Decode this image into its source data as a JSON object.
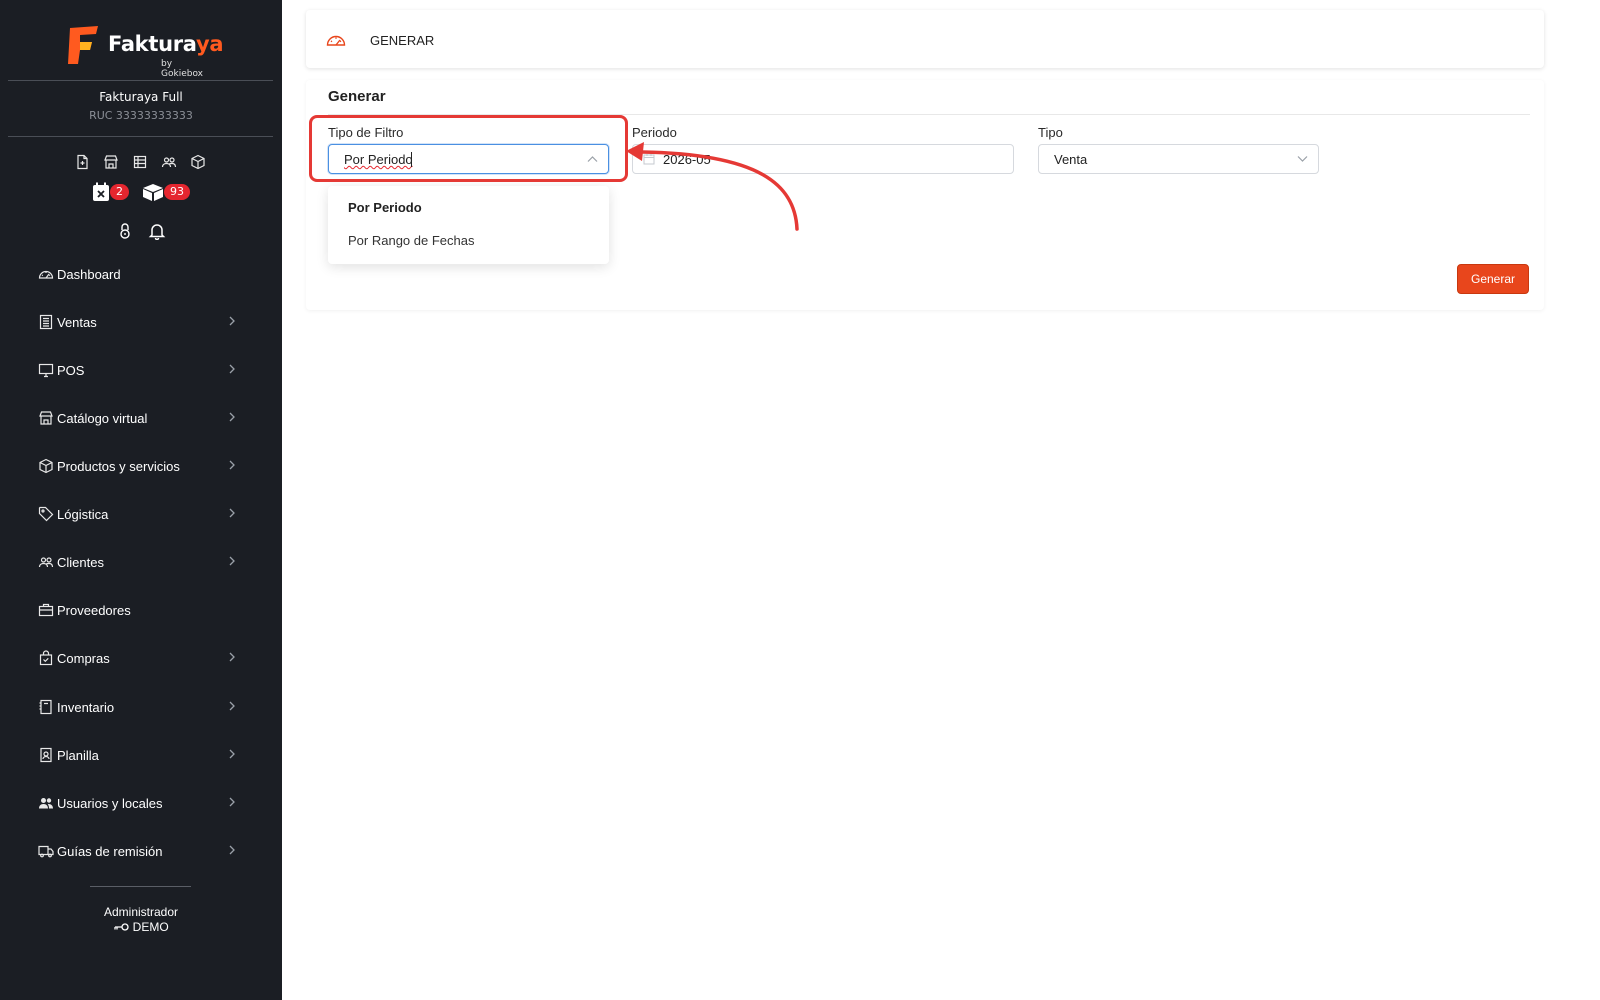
{
  "sidebar": {
    "logo": {
      "word_main": "Fakturaya",
      "word_main_a": "Fak",
      "word_main_b": "tura",
      "word_main_c": "ya",
      "sub": "by Gokiebox"
    },
    "company_name": "Fakturaya Full",
    "company_ruc": "RUC 33333333333",
    "quick_icons": [
      "document-icon",
      "store-icon",
      "table-icon",
      "users-icon",
      "box-icon"
    ],
    "badges": {
      "calendar_count": "2",
      "boxes_count": "93"
    },
    "menu": [
      {
        "label": "Dashboard",
        "icon": "dashboard-icon",
        "has_children": false
      },
      {
        "label": "Ventas",
        "icon": "sales-icon",
        "has_children": true
      },
      {
        "label": "POS",
        "icon": "monitor-icon",
        "has_children": true
      },
      {
        "label": "Catálogo virtual",
        "icon": "store-icon",
        "has_children": true
      },
      {
        "label": "Productos y servicios",
        "icon": "box-icon",
        "has_children": true
      },
      {
        "label": "Lógistica",
        "icon": "tag-icon",
        "has_children": true
      },
      {
        "label": "Clientes",
        "icon": "users-icon",
        "has_children": true
      },
      {
        "label": "Proveedores",
        "icon": "briefcase-icon",
        "has_children": false
      },
      {
        "label": "Compras",
        "icon": "bag-icon",
        "has_children": true
      },
      {
        "label": "Inventario",
        "icon": "book-icon",
        "has_children": true
      },
      {
        "label": "Planilla",
        "icon": "badge-icon",
        "has_children": true
      },
      {
        "label": "Usuarios y locales",
        "icon": "users-fill-icon",
        "has_children": true
      },
      {
        "label": "Guías de remisión",
        "icon": "truck-icon",
        "has_children": true
      }
    ],
    "user": {
      "role": "Administrador",
      "name": "DEMO"
    }
  },
  "topbar": {
    "title": "GENERAR"
  },
  "form": {
    "title": "Generar",
    "filter_type": {
      "label": "Tipo de Filtro",
      "value": "Por Periodo"
    },
    "period": {
      "label": "Periodo",
      "value": "2026-05"
    },
    "type": {
      "label": "Tipo",
      "value": "Venta"
    },
    "dropdown_options": [
      "Por Periodo",
      "Por Rango de Fechas"
    ],
    "submit_label": "Generar"
  },
  "colors": {
    "sidebar_bg": "#1b1e24",
    "accent": "#e8461c",
    "badge": "#e5262f",
    "highlight": "#e53935"
  }
}
